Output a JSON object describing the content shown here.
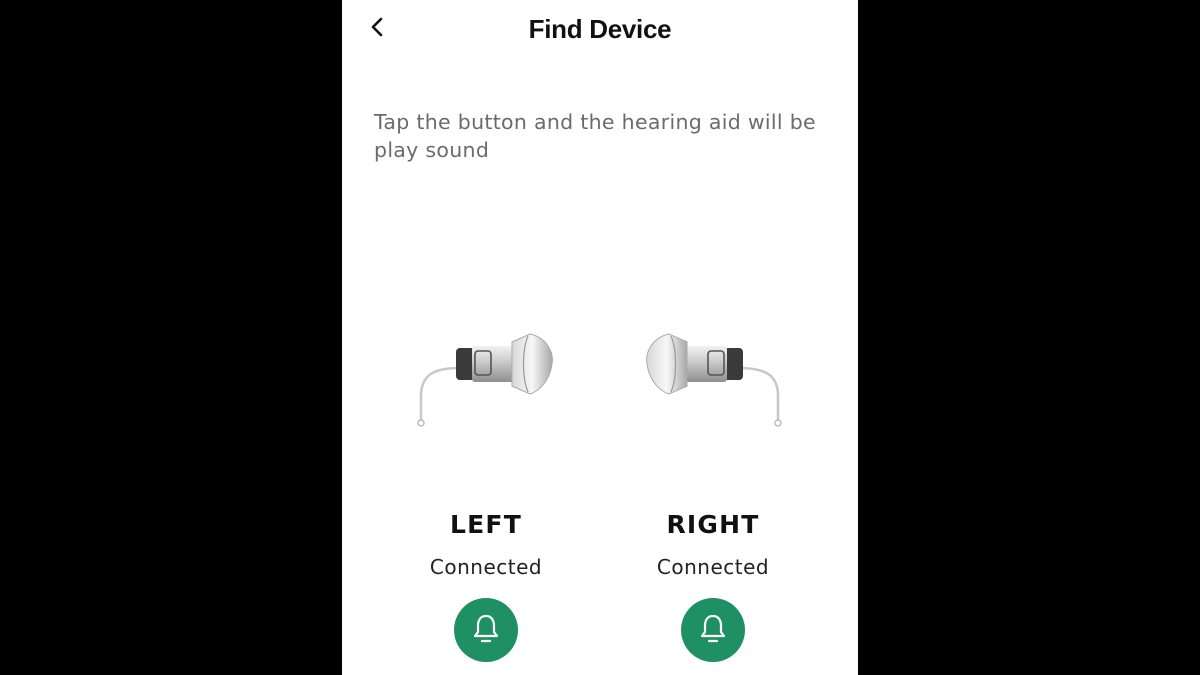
{
  "header": {
    "title": "Find Device",
    "back_icon": "chevron-left-icon"
  },
  "instructions": "Tap the button and the hearing aid will be play sound",
  "devices": [
    {
      "side": "LEFT",
      "status": "Connected",
      "button_icon": "bell-icon"
    },
    {
      "side": "RIGHT",
      "status": "Connected",
      "button_icon": "bell-icon"
    }
  ],
  "colors": {
    "accent": "#1e9063",
    "background": "#ffffff",
    "letterbox": "#000000",
    "instructions_text": "#6b6b6b"
  }
}
